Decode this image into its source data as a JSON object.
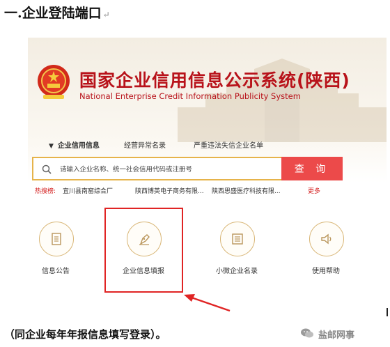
{
  "doc": {
    "heading": "一.企业登陆端口",
    "para_mark": "↵",
    "footer": "（同企业每年年报信息填写登录）。",
    "watermark": "盐邮网事"
  },
  "site": {
    "title": "国家企业信用信息公示系统(陕西)",
    "subtitle": "National Enterprise Credit Information Publicity System",
    "nav": [
      "企业信用信息",
      "经营异常名录",
      "严重违法失信企业名单"
    ],
    "search": {
      "placeholder": "请输入企业名称、统一社会信用代码或注册号",
      "button": "查 询"
    },
    "hot": {
      "label": "热搜榜:",
      "items": [
        "宜川县南窑综合厂",
        "陕西博英电子商务有限...",
        "陕西思盛医疗科技有限..."
      ],
      "more": "更多"
    },
    "tiles": [
      {
        "label": "信息公告",
        "icon": "document-icon"
      },
      {
        "label": "企业信息填报",
        "icon": "pen-icon"
      },
      {
        "label": "小微企业名录",
        "icon": "list-icon"
      },
      {
        "label": "使用帮助",
        "icon": "speaker-icon"
      }
    ]
  },
  "colors": {
    "brand_red": "#b8121a",
    "search_border": "#e6b34a",
    "search_button": "#ec4a4a",
    "highlight": "#e02424"
  }
}
